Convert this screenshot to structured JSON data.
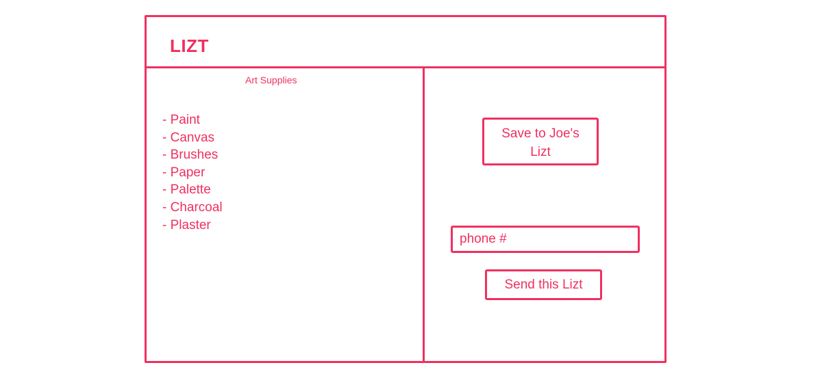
{
  "app": {
    "title": "LIZT"
  },
  "list": {
    "title": "Art Supplies",
    "items": [
      "Paint",
      "Canvas",
      "Brushes",
      "Paper",
      "Palette",
      "Charcoal",
      "Plaster"
    ]
  },
  "actions": {
    "save_label": "Save to Joe's Lizt",
    "phone_placeholder": "phone #",
    "send_label": "Send this Lizt"
  },
  "colors": {
    "accent": "#f0305f",
    "background": "#ffffff"
  }
}
